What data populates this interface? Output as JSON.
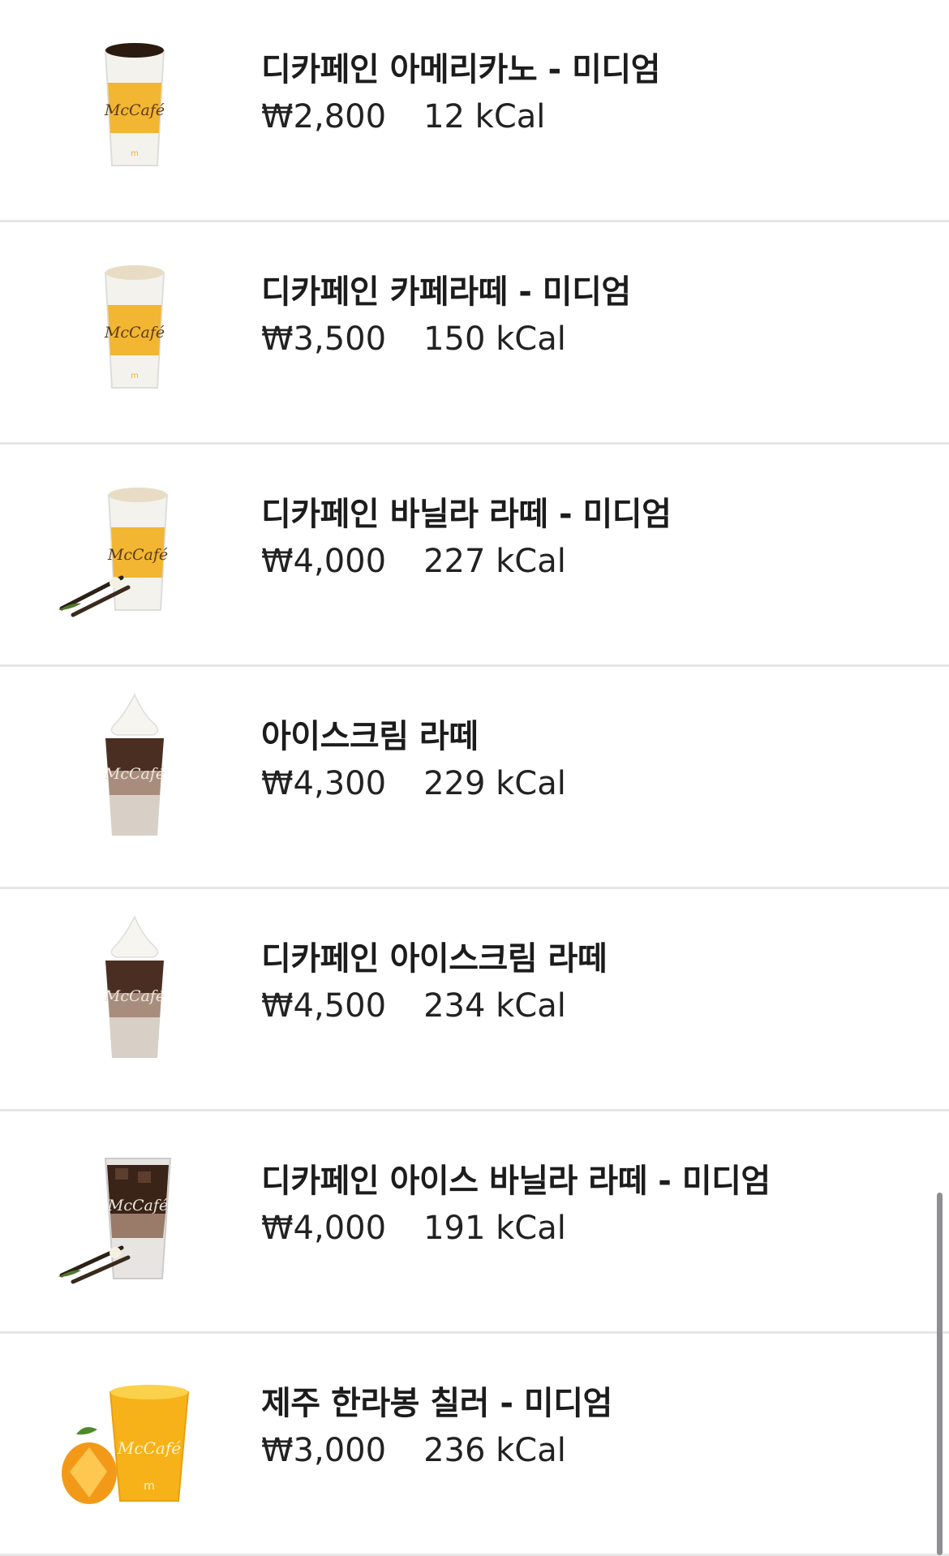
{
  "menu": {
    "items": [
      {
        "name": "디카페인 아메리카노 - 미디엄",
        "price": "₩2,800",
        "kcal": "12 kCal",
        "cup_logo": "McCafé"
      },
      {
        "name": "디카페인 카페라떼 - 미디엄",
        "price": "₩3,500",
        "kcal": "150 kCal",
        "cup_logo": "McCafé"
      },
      {
        "name": "디카페인 바닐라 라떼 - 미디엄",
        "price": "₩4,000",
        "kcal": "227 kCal",
        "cup_logo": "McCafé"
      },
      {
        "name": "아이스크림 라떼",
        "price": "₩4,300",
        "kcal": "229 kCal",
        "cup_logo": "McCafé"
      },
      {
        "name": "디카페인 아이스크림 라떼",
        "price": "₩4,500",
        "kcal": "234 kCal",
        "cup_logo": "McCafé"
      },
      {
        "name": "디카페인 아이스 바닐라 라떼 - 미디엄",
        "price": "₩4,000",
        "kcal": "191 kCal",
        "cup_logo": "McCafé"
      },
      {
        "name": "제주 한라봉 칠러 - 미디엄",
        "price": "₩3,000",
        "kcal": "236 kCal",
        "cup_logo": "McCafé"
      }
    ]
  },
  "colors": {
    "mccafe_yellow": "#f2b632",
    "divider": "#e6e6e6",
    "text": "#1c1c1c"
  }
}
